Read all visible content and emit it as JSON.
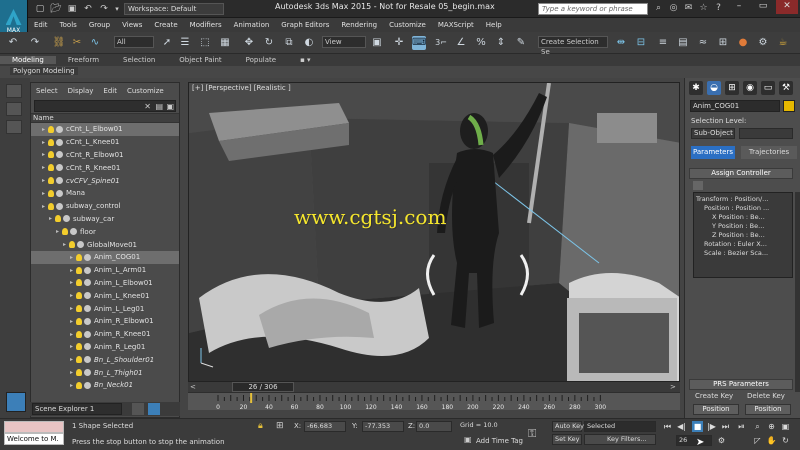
{
  "titlebar": {
    "logo_text": "MAX",
    "workspace": "Workspace: Default",
    "app_title": "Autodesk 3ds Max  2015  - Not for Resale    05_begin.max",
    "search_placeholder": "Type a keyword or phrase"
  },
  "menu": [
    "Edit",
    "Tools",
    "Group",
    "Views",
    "Create",
    "Modifiers",
    "Animation",
    "Graph Editors",
    "Rendering",
    "Customize",
    "MAXScript",
    "Help"
  ],
  "toolbar": {
    "selection_filter": "All",
    "ref_coord": "View",
    "selection_set": "Create Selection Se",
    "snap_label": "3"
  },
  "ribbon": {
    "tabs": [
      "Modeling",
      "Freeform",
      "Selection",
      "Object Paint",
      "Populate"
    ],
    "active": "Modeling",
    "sub": "Polygon Modeling"
  },
  "scene_explorer": {
    "menu": [
      "Select",
      "Display",
      "Edit",
      "Customize"
    ],
    "column_header": "Name",
    "rows": [
      {
        "label": "cCnt_L_Elbow01",
        "indent": 1,
        "sel": true
      },
      {
        "label": "cCnt_L_Knee01",
        "indent": 1
      },
      {
        "label": "cCnt_R_Elbow01",
        "indent": 1
      },
      {
        "label": "cCnt_R_Knee01",
        "indent": 1
      },
      {
        "label": "cvCFV_Spine01",
        "indent": 1,
        "italic": true
      },
      {
        "label": "Mana",
        "indent": 1
      },
      {
        "label": "subway_control",
        "indent": 1
      },
      {
        "label": "subway_car",
        "indent": 2
      },
      {
        "label": "floor",
        "indent": 3
      },
      {
        "label": "GlobalMove01",
        "indent": 4
      },
      {
        "label": "Anim_COG01",
        "indent": 5,
        "sel": true
      },
      {
        "label": "Anim_L_Arm01",
        "indent": 5
      },
      {
        "label": "Anim_L_Elbow01",
        "indent": 5
      },
      {
        "label": "Anim_L_Knee01",
        "indent": 5
      },
      {
        "label": "Anim_L_Leg01",
        "indent": 5
      },
      {
        "label": "Anim_R_Elbow01",
        "indent": 5
      },
      {
        "label": "Anim_R_Knee01",
        "indent": 5
      },
      {
        "label": "Anim_R_Leg01",
        "indent": 5
      },
      {
        "label": "Bn_L_Shoulder01",
        "indent": 5,
        "italic": true
      },
      {
        "label": "Bn_L_Thigh01",
        "indent": 5,
        "italic": true
      },
      {
        "label": "Bn_Neck01",
        "indent": 5,
        "italic": true
      }
    ],
    "footer": "Scene Explorer 1"
  },
  "viewport": {
    "label": "[+] [Perspective] [Realistic ]",
    "watermark": "www.cgtsj.com"
  },
  "command_panel": {
    "object_name": "Anim_COG01",
    "selection_level": "Selection Level:",
    "sub_object": "Sub-Object",
    "tab_params": "Parameters",
    "tab_traj": "Trajectories",
    "assign_controller": "Assign Controller",
    "tree": [
      "Transform : Position/...",
      "Position : Position ...",
      "X Position : Be...",
      "Y Position : Be...",
      "Z Position : Be...",
      "Rotation : Euler X...",
      "Scale : Bezier Sca..."
    ],
    "prs": "PRS Parameters",
    "create_key": "Create Key",
    "delete_key": "Delete Key",
    "position": "Position",
    "position2": "Position"
  },
  "timeline": {
    "slider": "26 / 306",
    "ticks": [
      "0",
      "20",
      "40",
      "60",
      "80",
      "100",
      "120",
      "140",
      "160",
      "180",
      "200",
      "220",
      "240",
      "260",
      "280",
      "300"
    ]
  },
  "status": {
    "selection": "1 Shape Selected",
    "prompt": "Press the stop button to stop the animation",
    "x_value": "-66.683",
    "y_value": "-77.353",
    "z_value": "0.0",
    "grid": "Grid = 10.0",
    "add_time_tag": "Add Time Tag",
    "auto_key": "Auto Key",
    "set_key": "Set Key",
    "selected": "Selected",
    "key_filters": "Key Filters...",
    "frame": "26",
    "listener": "Welcome to M."
  }
}
